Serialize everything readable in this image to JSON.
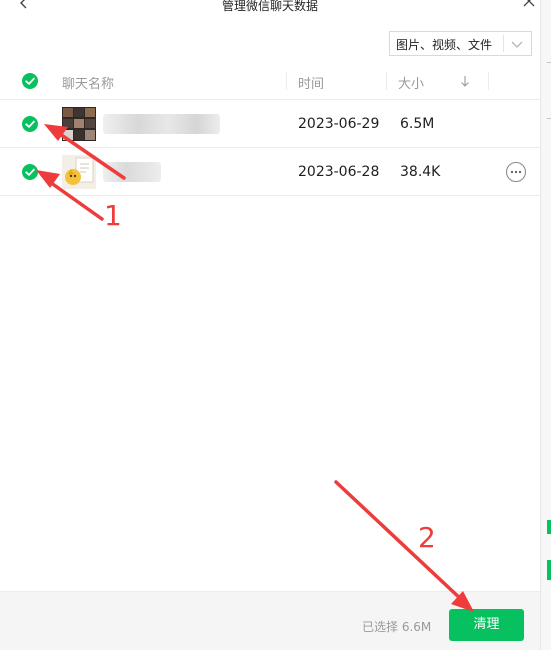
{
  "window": {
    "title": "管理微信聊天数据"
  },
  "filter": {
    "label": "图片、视频、文件"
  },
  "table": {
    "columns": {
      "name": "聊天名称",
      "time": "时间",
      "size": "大小"
    },
    "rows": [
      {
        "time": "2023-06-29",
        "size": "6.5M",
        "selected": true
      },
      {
        "time": "2023-06-28",
        "size": "38.4K",
        "selected": true
      }
    ]
  },
  "footer": {
    "selected_text": "已选择 6.6M",
    "clean_label": "清理"
  },
  "annotations": {
    "label1": "1",
    "label2": "2"
  },
  "colors": {
    "accent": "#07c160",
    "annotation": "#ee3b3b"
  },
  "icons": [
    "back-icon",
    "close-icon",
    "chevron-down-icon",
    "sort-down-icon",
    "check-icon",
    "more-icon"
  ]
}
